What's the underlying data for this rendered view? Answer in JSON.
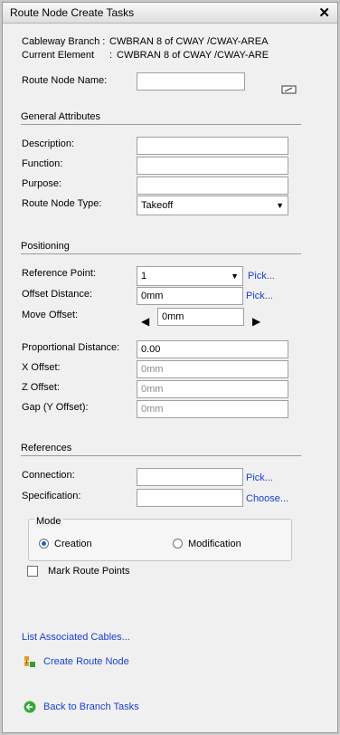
{
  "window": {
    "title": "Route Node Create Tasks"
  },
  "info": {
    "branch_label": "Cableway Branch :",
    "branch_value": "CWBRAN 8 of CWAY /CWAY-AREA",
    "element_label": "Current Element",
    "element_sep": ":",
    "element_value": "CWBRAN 8 of CWAY /CWAY-ARE"
  },
  "name_field": {
    "label": "Route Node Name:",
    "value": "",
    "icon": "edit-name-icon"
  },
  "general": {
    "heading": "General Attributes",
    "description_label": "Description:",
    "function_label": "Function:",
    "purpose_label": "Purpose:",
    "type_label": "Route Node Type:",
    "type_value": "Takeoff"
  },
  "positioning": {
    "heading": "Positioning",
    "ref_label": "Reference Point:",
    "ref_value": "1",
    "pick1": "Pick...",
    "offset_label": "Offset Distance:",
    "offset_value": "0mm",
    "pick2": "Pick...",
    "move_label": "Move Offset:",
    "move_value": "0mm",
    "prop_label": "Proportional Distance:",
    "prop_value": "0.00",
    "x_label": "X Offset:",
    "x_value": "0mm",
    "z_label": "Z Offset:",
    "z_value": "0mm",
    "gap_label": "Gap (Y Offset):",
    "gap_value": "0mm"
  },
  "references": {
    "heading": "References",
    "connection_label": "Connection:",
    "connection_pick": "Pick...",
    "spec_label": "Specification:",
    "spec_choose": "Choose..."
  },
  "mode": {
    "legend": "Mode",
    "creation": "Creation",
    "modification": "Modification",
    "selected": "Creation"
  },
  "mark_route_points": {
    "label": "Mark Route Points",
    "checked": false
  },
  "links": {
    "list_cables": "List Associated Cables...",
    "create_node": "Create Route Node",
    "back": "Back to Branch Tasks"
  }
}
